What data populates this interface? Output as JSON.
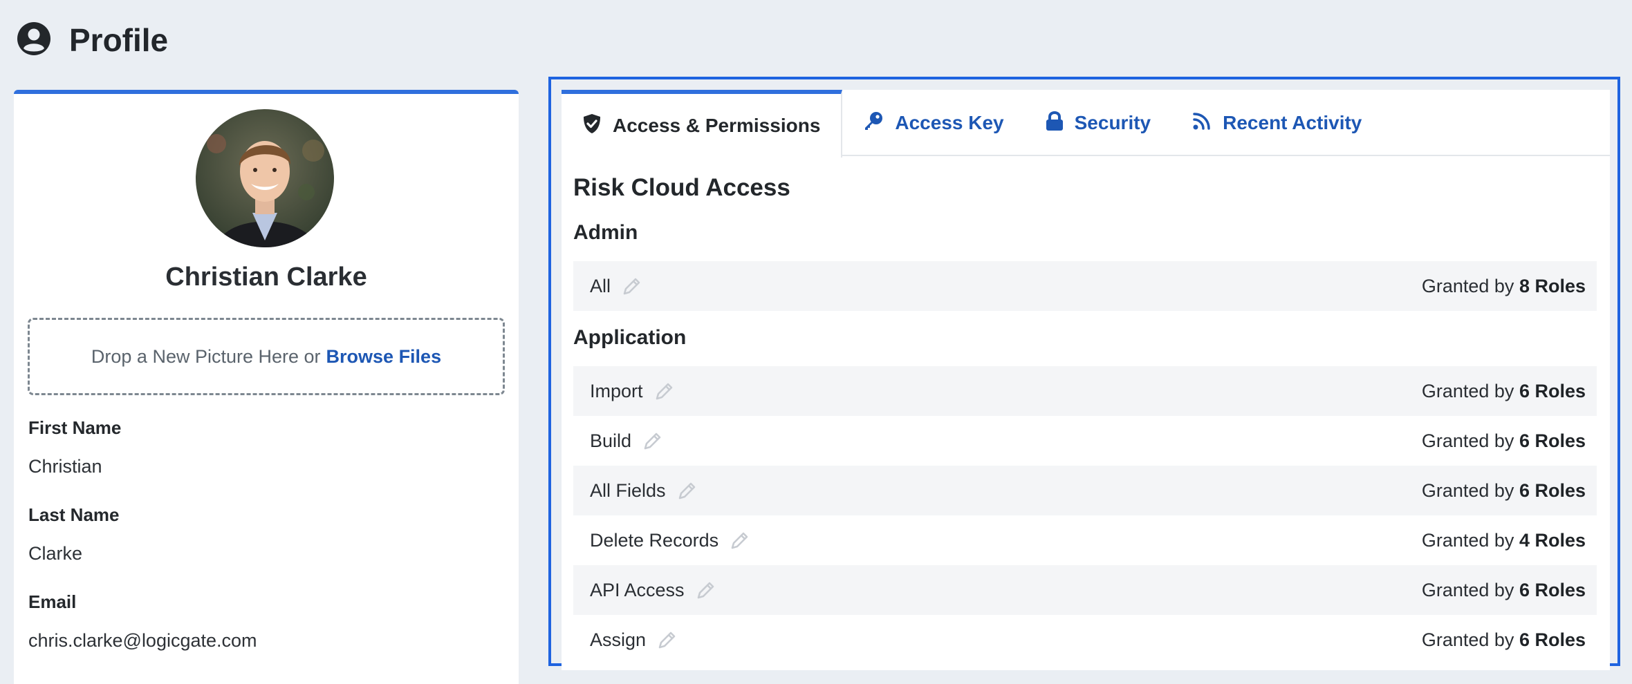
{
  "header": {
    "title": "Profile",
    "icon": "user-circle-icon"
  },
  "profile": {
    "name": "Christian Clarke",
    "dropzone": {
      "text": "Drop a New Picture Here or",
      "link": "Browse Files"
    },
    "fields": [
      {
        "label": "First Name",
        "value": "Christian"
      },
      {
        "label": "Last Name",
        "value": "Clarke"
      },
      {
        "label": "Email",
        "value": "chris.clarke@logicgate.com"
      }
    ]
  },
  "tabs": [
    {
      "label": "Access & Permissions",
      "icon": "shield-check-icon",
      "active": true
    },
    {
      "label": "Access Key",
      "icon": "key-icon",
      "active": false
    },
    {
      "label": "Security",
      "icon": "lock-icon",
      "active": false
    },
    {
      "label": "Recent Activity",
      "icon": "rss-feed-icon",
      "active": false
    }
  ],
  "access": {
    "title": "Risk Cloud Access",
    "groups": [
      {
        "title": "Admin",
        "rows": [
          {
            "label": "All",
            "granted_prefix": "Granted by",
            "granted_count": "8 Roles"
          }
        ]
      },
      {
        "title": "Application",
        "rows": [
          {
            "label": "Import",
            "granted_prefix": "Granted by",
            "granted_count": "6 Roles"
          },
          {
            "label": "Build",
            "granted_prefix": "Granted by",
            "granted_count": "6 Roles"
          },
          {
            "label": "All Fields",
            "granted_prefix": "Granted by",
            "granted_count": "6 Roles"
          },
          {
            "label": "Delete Records",
            "granted_prefix": "Granted by",
            "granted_count": "4 Roles"
          },
          {
            "label": "API Access",
            "granted_prefix": "Granted by",
            "granted_count": "6 Roles"
          },
          {
            "label": "Assign",
            "granted_prefix": "Granted by",
            "granted_count": "6 Roles"
          }
        ]
      }
    ]
  },
  "colors": {
    "accent": "#2f6fdd",
    "link": "#1d57b4",
    "focus_outline": "#1e63e0",
    "background": "#eaeef3"
  }
}
